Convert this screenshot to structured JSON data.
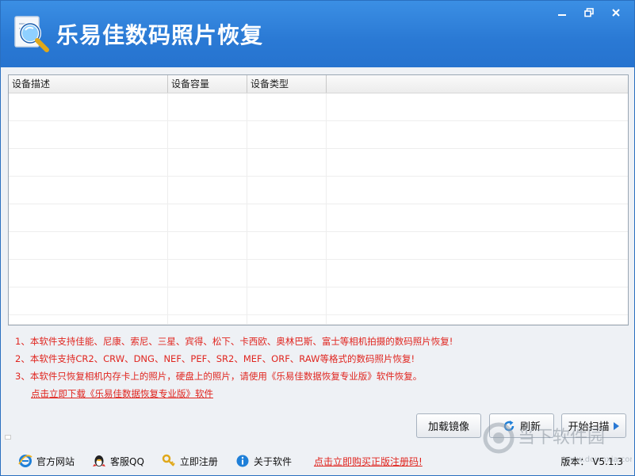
{
  "app": {
    "title": "乐易佳数码照片恢复"
  },
  "table": {
    "columns": [
      "设备描述",
      "设备容量",
      "设备类型"
    ]
  },
  "notes": [
    "1、本软件支持佳能、尼康、索尼、三星、宾得、松下、卡西欧、奥林巴斯、富士等相机拍摄的数码照片恢复!",
    "2、本软件支持CR2、CRW、DNG、NEF、PEF、SR2、MEF、ORF、RAW等格式的数码照片恢复!",
    "3、本软件只恢复相机内存卡上的照片，硬盘上的照片，请使用《乐易佳数据恢复专业版》软件恢复。"
  ],
  "download_link": "点击立即下载《乐易佳数据恢复专业版》软件",
  "buttons": {
    "load_image": "加载镜像",
    "refresh": "刷新",
    "start_scan": "开始扫描"
  },
  "footer": {
    "website": "官方网站",
    "qq": "客服QQ",
    "register": "立即注册",
    "about": "关于软件",
    "buy": "点击立即购买正版注册码!",
    "version_label": "版本：",
    "version": "V5.1.3"
  },
  "watermark": {
    "text": "当下软件园",
    "url": "www.downxia.com"
  },
  "colors": {
    "titlebar": "#2a79d4",
    "accent_red": "#e0251f"
  }
}
